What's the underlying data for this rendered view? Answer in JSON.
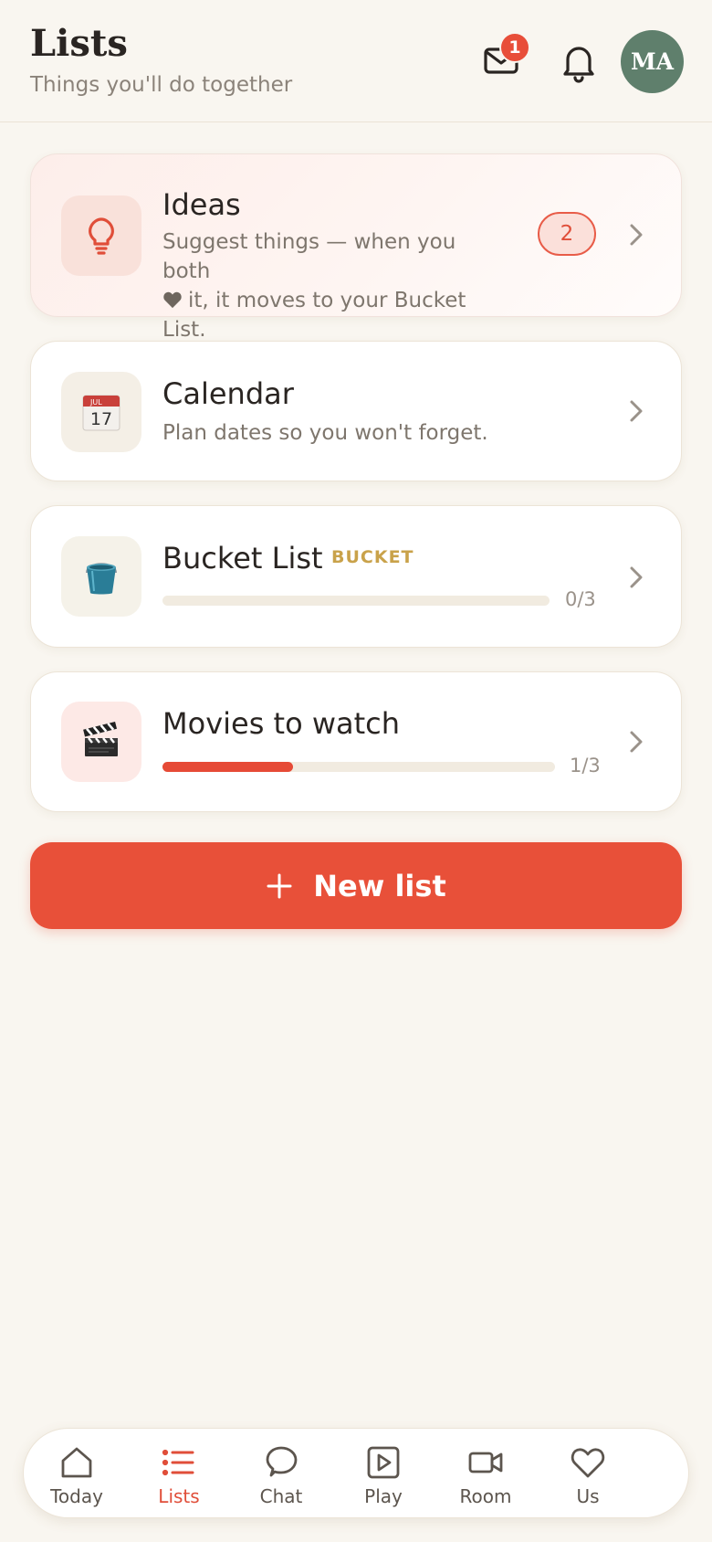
{
  "header": {
    "title": "Lists",
    "subtitle": "Things you'll do together",
    "mail_badge": "1",
    "avatar_initials": "MA"
  },
  "cards": {
    "ideas": {
      "title": "Ideas",
      "description_line1": "Suggest things — when you both",
      "description_line2": "it, it moves to your Bucket List.",
      "count": "2",
      "icon": "lightbulb-icon"
    },
    "calendar": {
      "title": "Calendar",
      "description": "Plan dates so you won't forget.",
      "icon_month": "JUL",
      "icon_day": "17",
      "icon": "calendar-icon"
    },
    "bucket": {
      "title": "Bucket List",
      "tag": "BUCKET",
      "progress_text": "0/3",
      "progress": 0,
      "icon": "bucket-icon"
    },
    "movies": {
      "title": "Movies to watch",
      "progress_text": "1/3",
      "progress": 0.333,
      "icon": "clapper-icon"
    }
  },
  "new_list_label": "New list",
  "nav": [
    {
      "label": "Today",
      "icon": "home-icon"
    },
    {
      "label": "Lists",
      "icon": "list-icon",
      "active": true
    },
    {
      "label": "Chat",
      "icon": "chat-icon"
    },
    {
      "label": "Play",
      "icon": "play-icon"
    },
    {
      "label": "Room",
      "icon": "video-icon"
    },
    {
      "label": "Us",
      "icon": "heart-icon"
    }
  ],
  "colors": {
    "accent": "#e85039",
    "background": "#f9f6f0",
    "avatar": "#5f7f6c",
    "tag": "#c9a24a"
  }
}
